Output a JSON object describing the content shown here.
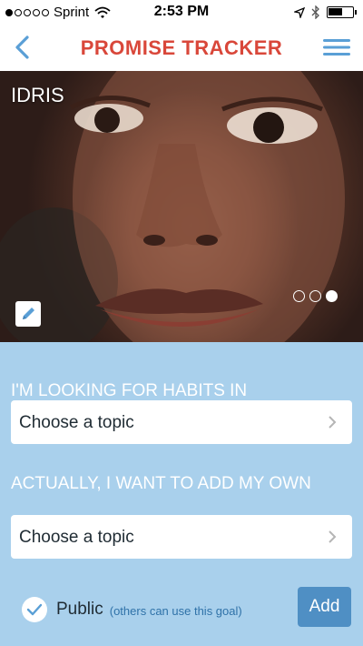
{
  "status_bar": {
    "carrier": "Sprint",
    "time": "2:53 PM",
    "signal_strength": 1,
    "signal_max": 5,
    "battery_level": 0.6,
    "icons": [
      "signal-dots-icon",
      "wifi-icon",
      "location-arrow-icon",
      "bluetooth-icon",
      "battery-icon"
    ]
  },
  "nav": {
    "title": "PROMISE TRACKER",
    "back_icon": "chevron-left-icon",
    "menu_icon": "hamburger-menu-icon"
  },
  "profile": {
    "name": "IDRIS",
    "edit_icon": "pencil-icon",
    "photo_pages": 3,
    "active_page": 3
  },
  "form": {
    "habits_label": "I'M LOOKING FOR HABITS IN",
    "topic_select_1": {
      "value": "Choose a topic"
    },
    "own_label": "ACTUALLY, I WANT TO ADD MY OWN",
    "topic_select_2": {
      "value": "Choose a topic"
    },
    "public_checked": true,
    "public_label": "Public",
    "public_hint": "(others can use this goal)",
    "add_label": "Add"
  },
  "colors": {
    "brand": "#d9473a",
    "accent": "#5a9fd6",
    "form_bg": "#a9d0ec",
    "button_bg": "#4f8fc4"
  }
}
